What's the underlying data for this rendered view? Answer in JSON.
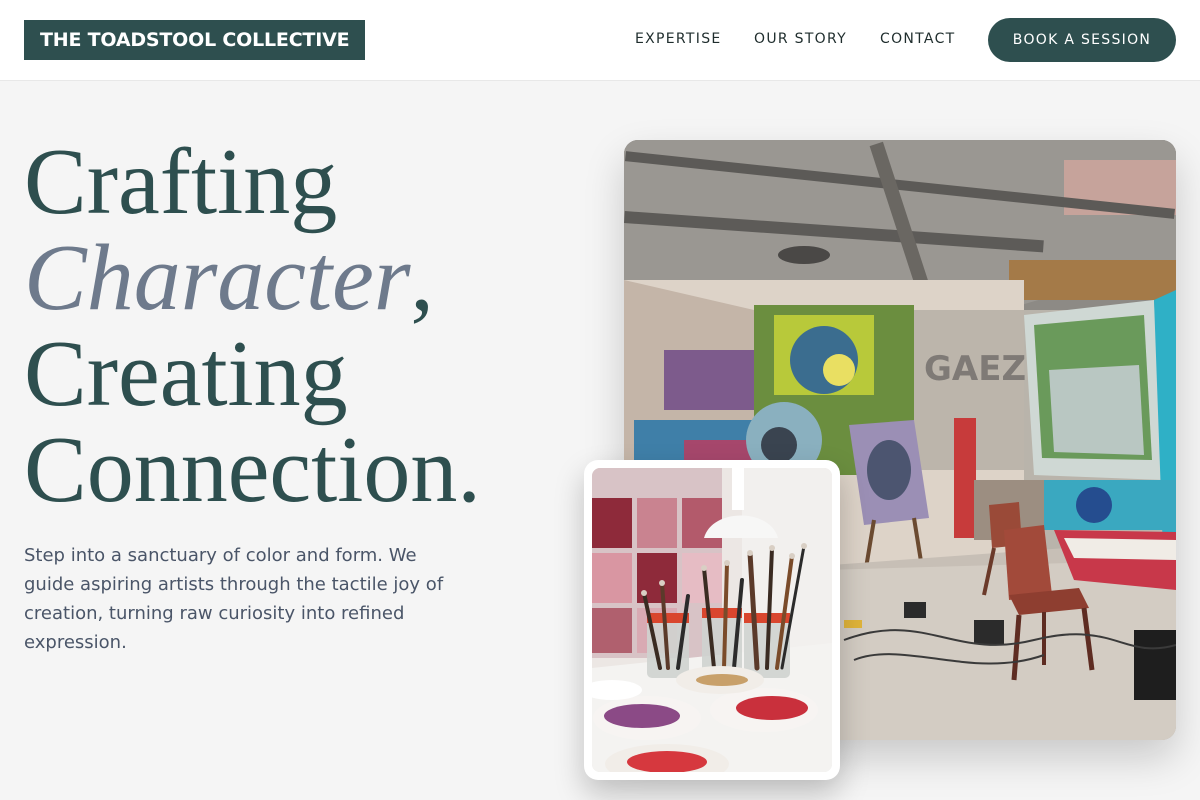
{
  "header": {
    "logo": "THE TOADSTOOL COLLECTIVE",
    "nav": [
      "EXPERTISE",
      "OUR STORY",
      "CONTACT"
    ],
    "cta": "BOOK A SESSION"
  },
  "hero": {
    "headline": {
      "line1": "Crafting",
      "line2_accent": "Character",
      "line2_punct": ",",
      "line3": "Creating",
      "line4": "Connection."
    },
    "lede": "Step into a sanctuary of color and form. We guide aspiring artists through the tactile joy of creation, turning raw curiosity into refined expression."
  },
  "colors": {
    "brand": "#2e4f4f",
    "accent_text": "#6e7a8c",
    "background": "#f5f5f5",
    "body_text": "#4a5568"
  }
}
